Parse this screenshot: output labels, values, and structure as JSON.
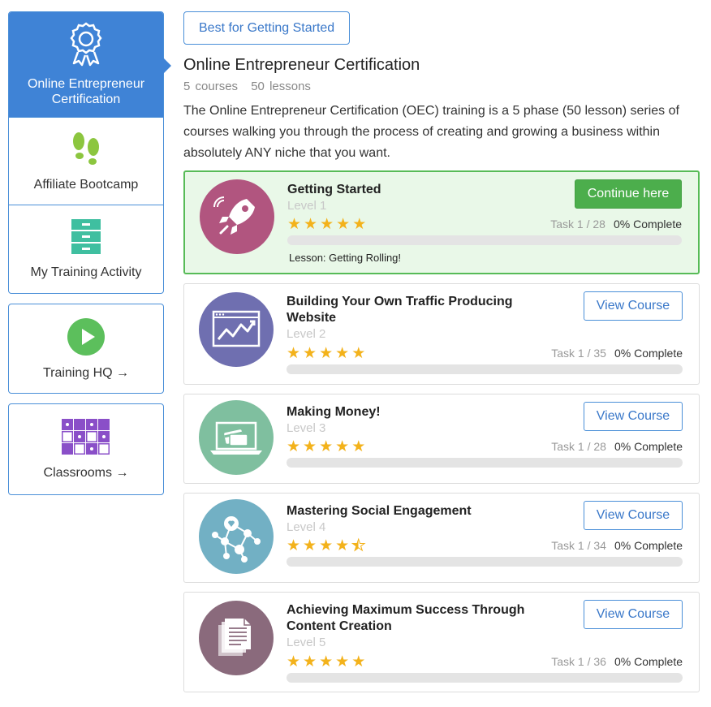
{
  "sidebar": {
    "items": [
      {
        "label": "Online Entrepreneur Certification",
        "icon": "award-ribbon-icon",
        "active": true
      },
      {
        "label": "Affiliate Bootcamp",
        "icon": "footprints-icon",
        "active": false
      },
      {
        "label": "My Training Activity",
        "icon": "file-cabinet-icon",
        "active": false
      },
      {
        "label": "Training HQ →",
        "icon": "play-circle-icon",
        "active": false
      },
      {
        "label": "Classrooms →",
        "icon": "grid-icon",
        "active": false
      }
    ]
  },
  "header": {
    "chip_label": "Best for Getting Started",
    "title": "Online Entrepreneur Certification",
    "courses_count": "5 courses",
    "lessons_count": "50 lessons",
    "description": "The Online Entrepreneur Certification (OEC) training is a 5 phase (50 lesson) series of courses walking you through the process of creating and growing a business within absolutely ANY niche that you want."
  },
  "courses": [
    {
      "title": "Getting Started",
      "level": "Level 1",
      "rating": 5,
      "task": "Task 1 / 28",
      "complete": "0% Complete",
      "progress": 0,
      "button": "Continue here",
      "lesson": "Lesson: Getting Rolling!",
      "icon": "rocket-icon",
      "color": "#b1557f"
    },
    {
      "title": "Building Your Own Traffic Producing Website",
      "level": "Level 2",
      "rating": 5,
      "task": "Task 1 / 35",
      "complete": "0% Complete",
      "progress": 0,
      "button": "View Course",
      "icon": "website-chart-icon",
      "color": "#6f6fb0"
    },
    {
      "title": "Making Money!",
      "level": "Level 3",
      "rating": 5,
      "task": "Task 1 / 28",
      "complete": "0% Complete",
      "progress": 0,
      "button": "View Course",
      "icon": "laptop-credit-card-icon",
      "color": "#7fbf9f"
    },
    {
      "title": "Mastering Social Engagement",
      "level": "Level 4",
      "rating": 4.5,
      "task": "Task 1 / 34",
      "complete": "0% Complete",
      "progress": 0,
      "button": "View Course",
      "icon": "social-network-icon",
      "color": "#72b0c4"
    },
    {
      "title": "Achieving Maximum Success Through Content Creation",
      "level": "Level 5",
      "rating": 5,
      "task": "Task 1 / 36",
      "complete": "0% Complete",
      "progress": 0,
      "button": "View Course",
      "icon": "documents-icon",
      "color": "#8a6a7c"
    }
  ],
  "colors": {
    "accent_blue": "#3f83d6",
    "success_green": "#4cae4c",
    "star_yellow": "#f3b21b"
  }
}
